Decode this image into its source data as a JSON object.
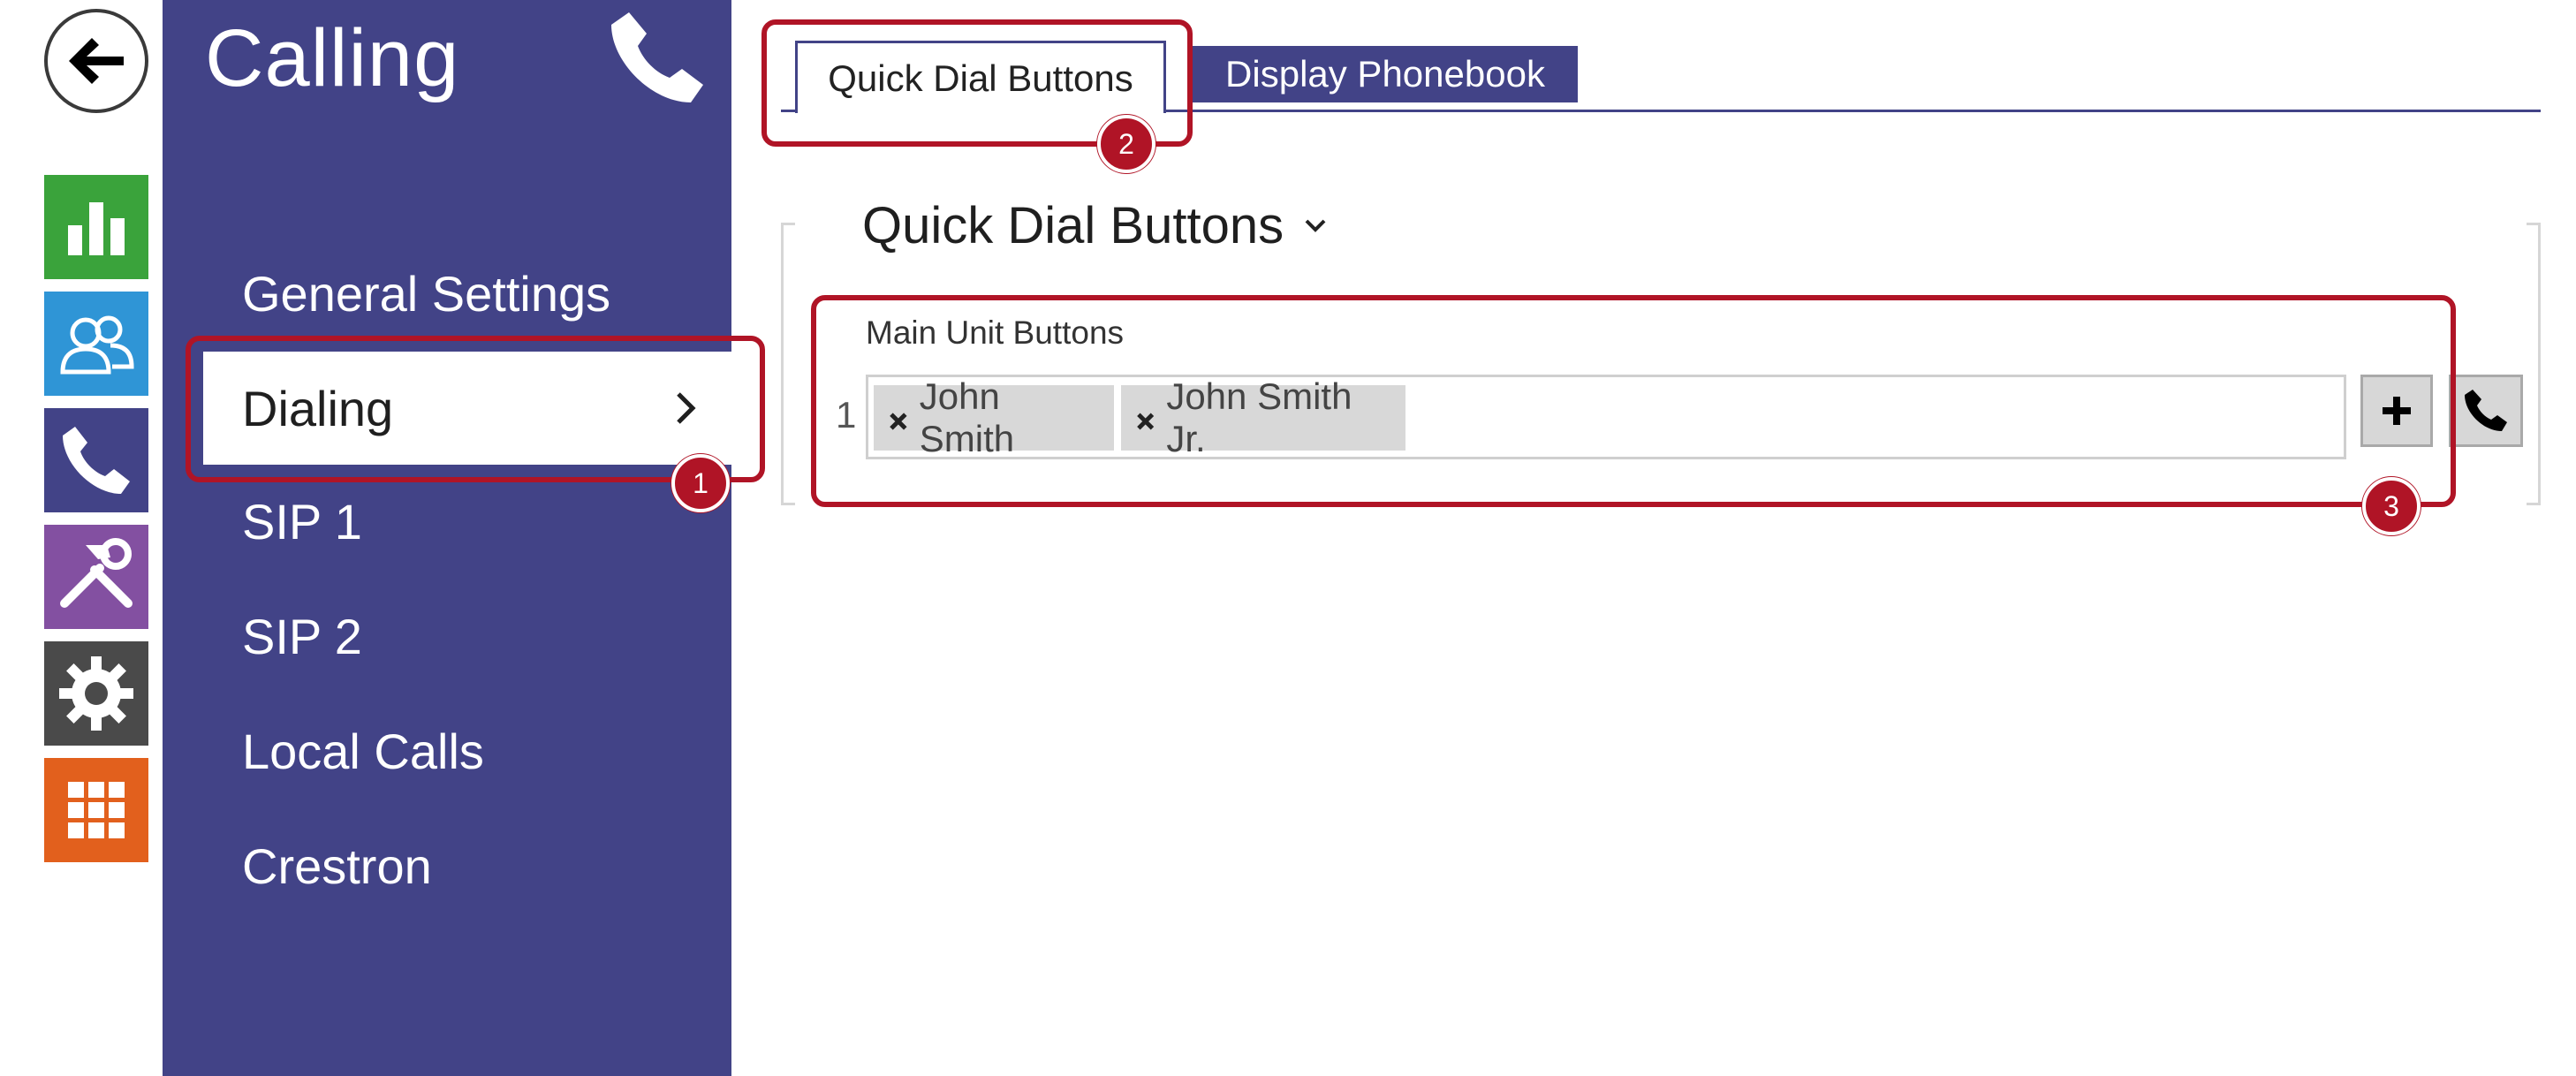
{
  "sidebar": {
    "title": "Calling",
    "items": [
      {
        "label": "General Settings"
      },
      {
        "label": "Dialing"
      },
      {
        "label": "SIP 1"
      },
      {
        "label": "SIP 2"
      },
      {
        "label": "Local Calls"
      },
      {
        "label": "Crestron"
      }
    ]
  },
  "rail": {
    "icons": [
      "back-icon",
      "status-chart-icon",
      "directory-icon",
      "calling-icon",
      "tools-icon",
      "settings-icon",
      "apps-grid-icon"
    ],
    "colors": [
      "#3aa33b",
      "#2f95d6",
      "#424387",
      "#8350a1",
      "#4a4a4a",
      "#e2601d"
    ]
  },
  "tabs": [
    {
      "label": "Quick Dial Buttons",
      "active": true
    },
    {
      "label": "Display Phonebook",
      "active": false
    }
  ],
  "section": {
    "title": "Quick Dial Buttons",
    "group_label": "Main Unit Buttons",
    "rows": [
      {
        "number": "1",
        "chips": [
          "John Smith",
          "John Smith Jr."
        ]
      }
    ]
  },
  "annotations": [
    "1",
    "2",
    "3"
  ],
  "colors": {
    "sidebar": "#424387",
    "accent": "#b01426"
  }
}
